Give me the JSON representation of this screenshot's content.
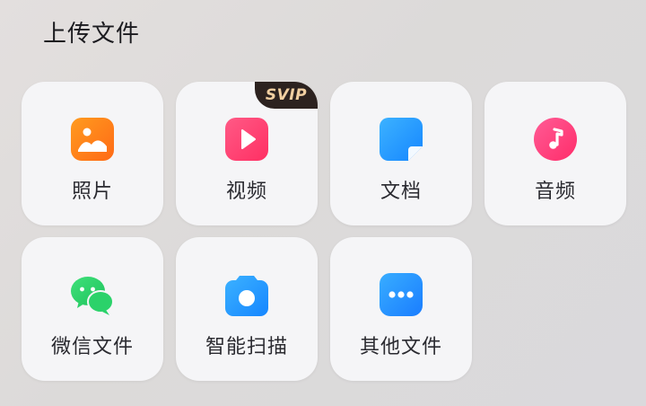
{
  "header": {
    "title": "上传文件"
  },
  "tiles": [
    {
      "label": "照片",
      "icon": "photo-icon",
      "color": "#ff7a1a"
    },
    {
      "label": "视频",
      "icon": "video-icon",
      "color": "#ff3d6e",
      "badge": "SVIP"
    },
    {
      "label": "文档",
      "icon": "document-icon",
      "color": "#1a9dff"
    },
    {
      "label": "音频",
      "icon": "music-icon",
      "color": "#ff3d7f"
    },
    {
      "label": "微信文件",
      "icon": "wechat-icon",
      "color": "#2fd46b"
    },
    {
      "label": "智能扫描",
      "icon": "camera-icon",
      "color": "#1a9dff"
    },
    {
      "label": "其他文件",
      "icon": "more-icon",
      "color": "#1a8eff"
    }
  ],
  "colors": {
    "badge_bg": "#2c221f",
    "badge_text": "#f1cfa1"
  }
}
